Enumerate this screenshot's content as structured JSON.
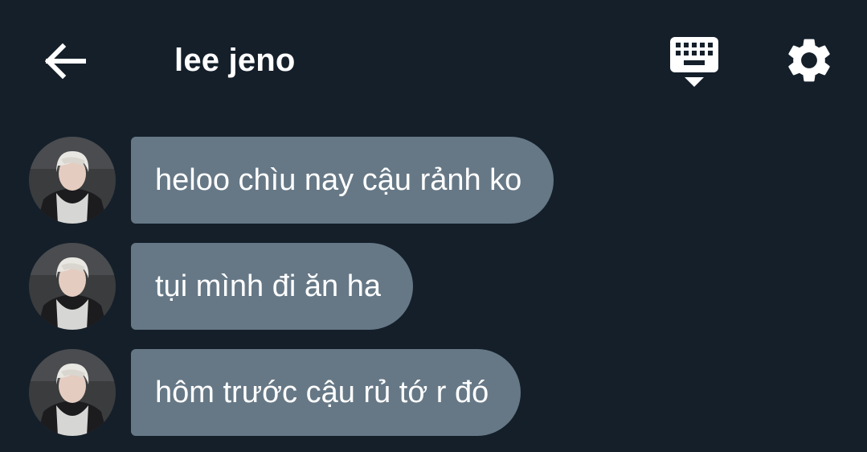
{
  "header": {
    "back_icon": "arrow-left-icon",
    "title": "lee jeno",
    "keyboard_icon": "keyboard-icon",
    "settings_icon": "gear-icon"
  },
  "messages": [
    {
      "text": "heloo chìu nay cậu rảnh ko"
    },
    {
      "text": "tụi mình đi ăn ha"
    },
    {
      "text": "hôm trước cậu rủ tớ r đó"
    }
  ],
  "colors": {
    "background": "#141f2a",
    "bubble": "#667886",
    "text": "#ffffff"
  }
}
